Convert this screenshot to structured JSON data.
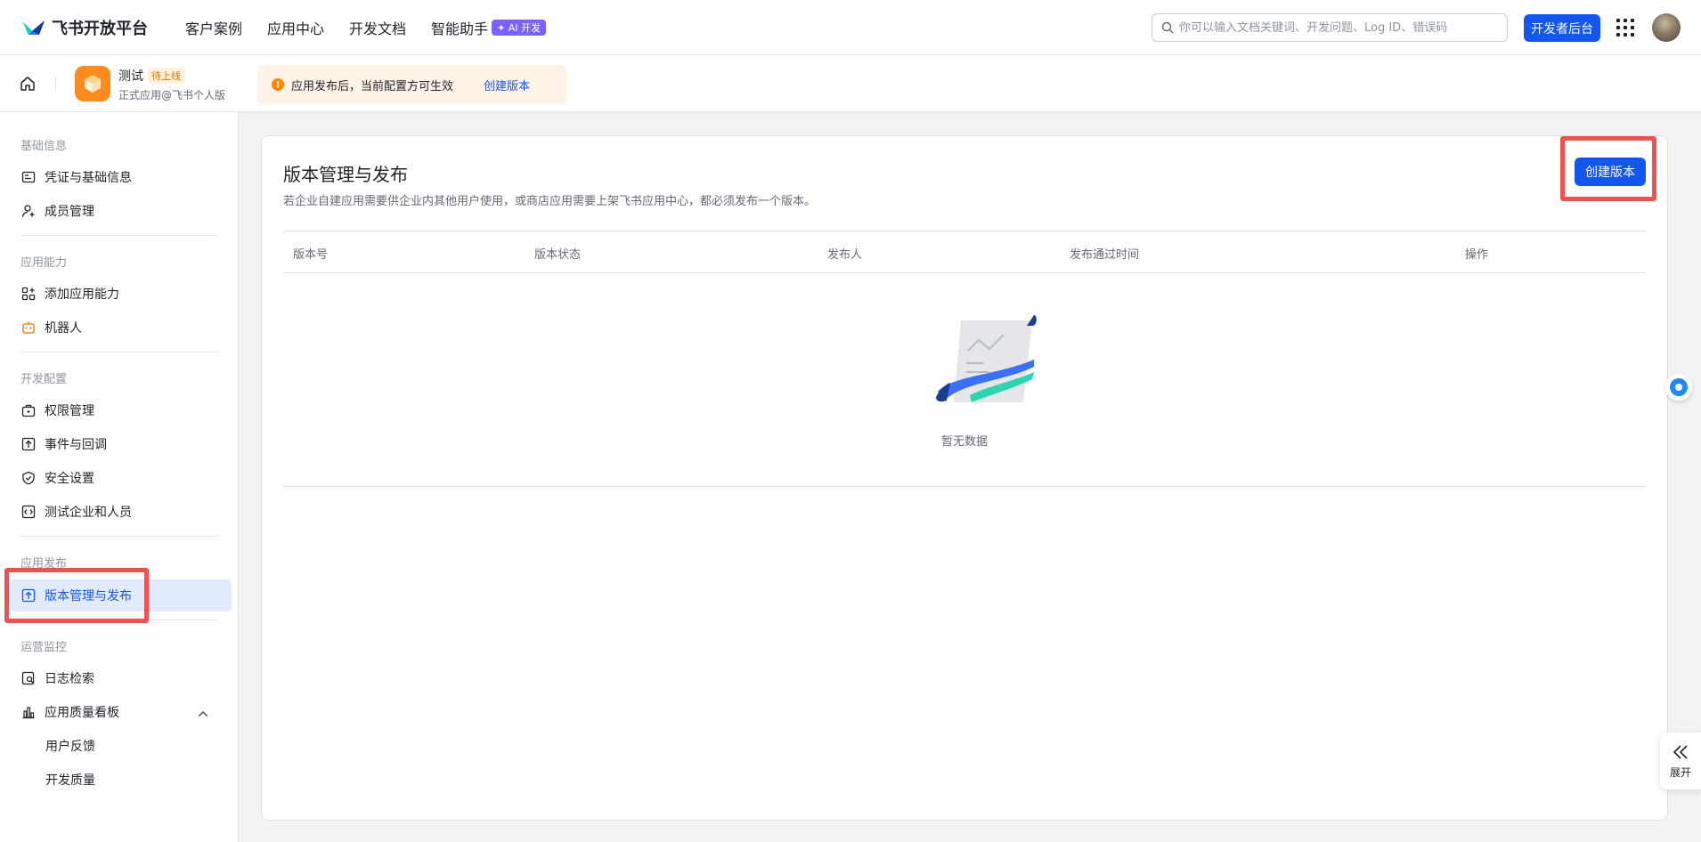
{
  "topnav": {
    "brand": "飞书开放平台",
    "links": [
      "客户案例",
      "应用中心",
      "开发文档",
      "智能助手"
    ],
    "ai_badge": "✦ AI 开发",
    "search_placeholder": "你可以输入文档关键词、开发问题、Log ID、错误码",
    "dev_console_label": "开发者后台"
  },
  "app": {
    "name": "测试",
    "status": "待上线",
    "subtitle": "正式应用@飞书个人版"
  },
  "notice": {
    "text": "应用发布后，当前配置方可生效",
    "link": "创建版本"
  },
  "sidebar": {
    "groups": [
      {
        "title": "基础信息",
        "items": [
          "凭证与基础信息",
          "成员管理"
        ]
      },
      {
        "title": "应用能力",
        "items": [
          "添加应用能力",
          "机器人"
        ]
      },
      {
        "title": "开发配置",
        "items": [
          "权限管理",
          "事件与回调",
          "安全设置",
          "测试企业和人员"
        ]
      },
      {
        "title": "应用发布",
        "items": [
          "版本管理与发布"
        ]
      },
      {
        "title": "运营监控",
        "items": [
          "日志检索",
          "应用质量看板",
          "用户反馈",
          "开发质量"
        ]
      }
    ]
  },
  "main": {
    "title": "版本管理与发布",
    "description": "若企业自建应用需要供企业内其他用户使用，或商店应用需要上架飞书应用中心，都必须发布一个版本。",
    "create_button": "创建版本",
    "columns": [
      "版本号",
      "版本状态",
      "发布人",
      "发布通过时间",
      "操作"
    ],
    "empty_text": "暂无数据"
  },
  "expand_label": "展开",
  "colors": {
    "primary": "#1456f0",
    "highlight": "#f05252",
    "app_icon": "#ff8b1f"
  }
}
